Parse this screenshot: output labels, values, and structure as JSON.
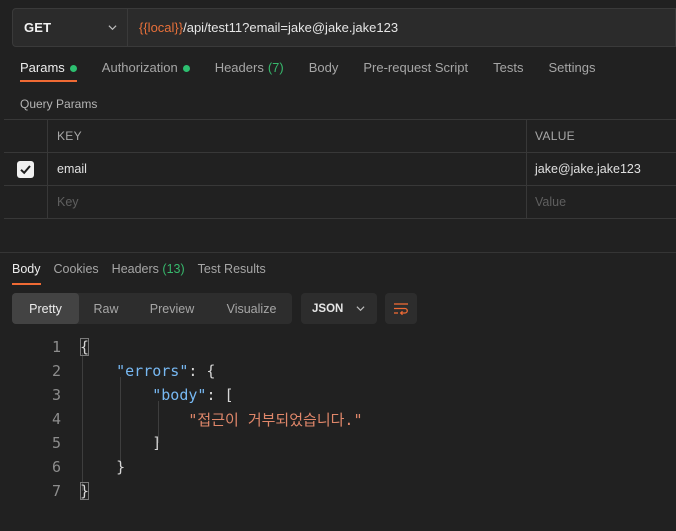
{
  "request": {
    "method": "GET",
    "url_var": "{{local}}",
    "url_rest": "/api/test11?email=jake@jake.jake123"
  },
  "request_tabs": [
    {
      "label": "Params",
      "dot": true,
      "count": "",
      "active": true
    },
    {
      "label": "Authorization",
      "dot": true,
      "count": "",
      "active": false
    },
    {
      "label": "Headers",
      "dot": false,
      "count": "(7)",
      "active": false
    },
    {
      "label": "Body",
      "dot": false,
      "count": "",
      "active": false
    },
    {
      "label": "Pre-request Script",
      "dot": false,
      "count": "",
      "active": false
    },
    {
      "label": "Tests",
      "dot": false,
      "count": "",
      "active": false
    },
    {
      "label": "Settings",
      "dot": false,
      "count": "",
      "active": false
    }
  ],
  "query_params": {
    "title": "Query Params",
    "key_header": "KEY",
    "value_header": "VALUE",
    "rows": [
      {
        "checked": true,
        "key": "email",
        "value": "jake@jake.jake123"
      }
    ],
    "key_placeholder": "Key",
    "value_placeholder": "Value"
  },
  "response_tabs": [
    {
      "label": "Body",
      "count": "",
      "active": true
    },
    {
      "label": "Cookies",
      "count": "",
      "active": false
    },
    {
      "label": "Headers",
      "count": "(13)",
      "active": false
    },
    {
      "label": "Test Results",
      "count": "",
      "active": false
    }
  ],
  "view_modes": [
    {
      "label": "Pretty",
      "active": true
    },
    {
      "label": "Raw",
      "active": false
    },
    {
      "label": "Preview",
      "active": false
    },
    {
      "label": "Visualize",
      "active": false
    }
  ],
  "format": "JSON",
  "icons": {
    "method_dropdown": "chevron-down-icon",
    "format_dropdown": "chevron-down-icon",
    "wrap": "wrap-lines-icon",
    "checkbox": "checkmark-icon"
  },
  "colors": {
    "accent": "#ef6a34",
    "status_green": "#2dbf70",
    "json_key": "#77b8f2",
    "json_string": "#e0876a"
  },
  "code_lines": [
    {
      "n": "1",
      "text": "{"
    },
    {
      "n": "2",
      "text": "    \"errors\": {"
    },
    {
      "n": "3",
      "text": "        \"body\": ["
    },
    {
      "n": "4",
      "text": "            \"접근이 거부되었습니다.\""
    },
    {
      "n": "5",
      "text": "        ]"
    },
    {
      "n": "6",
      "text": "    }"
    },
    {
      "n": "7",
      "text": "}"
    }
  ]
}
